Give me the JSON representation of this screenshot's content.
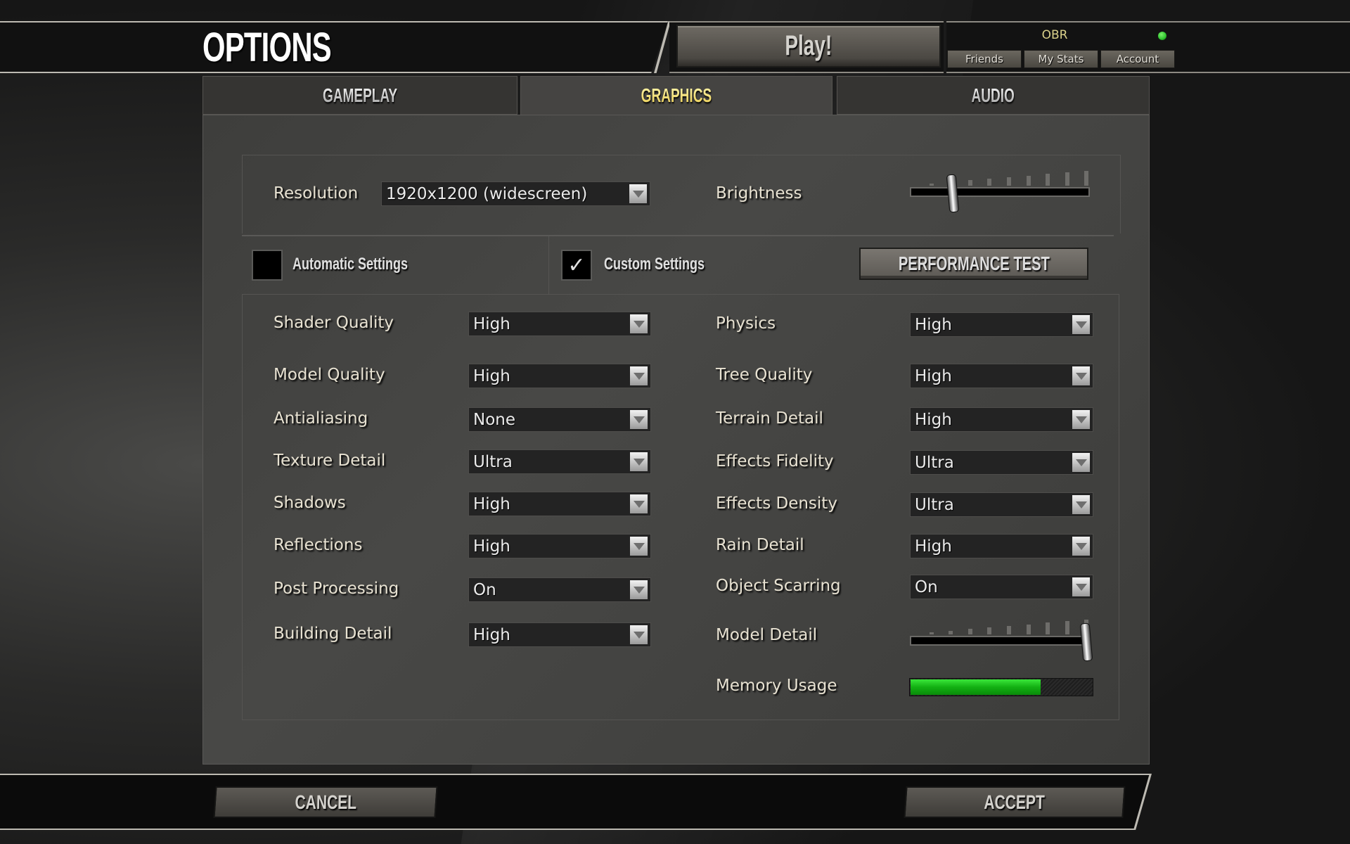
{
  "header": {
    "title": "OPTIONS",
    "play_label": "Play!",
    "user_name": "OBR",
    "status_color": "#2ec22e",
    "account_buttons": [
      "Friends",
      "My Stats",
      "Account"
    ]
  },
  "tabs": [
    {
      "label": "GAMEPLAY",
      "active": false
    },
    {
      "label": "GRAPHICS",
      "active": true
    },
    {
      "label": "AUDIO",
      "active": false
    }
  ],
  "display": {
    "resolution_label": "Resolution",
    "resolution_value": "1920x1200 (widescreen)",
    "brightness_label": "Brightness",
    "brightness_value": 0.22
  },
  "presets": {
    "automatic_label": "Automatic Settings",
    "automatic_checked": false,
    "custom_label": "Custom Settings",
    "custom_checked": true,
    "check_glyph": "✓",
    "performance_test_label": "PERFORMANCE TEST"
  },
  "left_settings": [
    {
      "label": "Shader Quality",
      "value": "High"
    },
    {
      "label": "Model Quality",
      "value": "High"
    },
    {
      "label": "Antialiasing",
      "value": "None"
    },
    {
      "label": "Texture Detail",
      "value": "Ultra"
    },
    {
      "label": "Shadows",
      "value": "High"
    },
    {
      "label": "Reflections",
      "value": "High"
    },
    {
      "label": "Post Processing",
      "value": "On"
    },
    {
      "label": "Building Detail",
      "value": "High"
    }
  ],
  "right_settings": [
    {
      "label": "Physics",
      "value": "High"
    },
    {
      "label": "Tree Quality",
      "value": "High"
    },
    {
      "label": "Terrain Detail",
      "value": "High"
    },
    {
      "label": "Effects Fidelity",
      "value": "Ultra"
    },
    {
      "label": "Effects Density",
      "value": "Ultra"
    },
    {
      "label": "Rain Detail",
      "value": "High"
    },
    {
      "label": "Object Scarring",
      "value": "On"
    }
  ],
  "model_detail": {
    "label": "Model Detail",
    "value": 1.0
  },
  "memory_usage": {
    "label": "Memory Usage",
    "value": 0.71,
    "color": "#12b012"
  },
  "footer": {
    "cancel_label": "CANCEL",
    "accept_label": "ACCEPT"
  }
}
